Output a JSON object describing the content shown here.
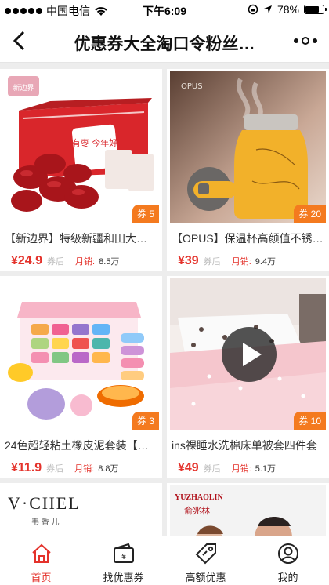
{
  "status": {
    "carrier": "中国电信",
    "time": "下午6:09",
    "battery": "78%",
    "battery_level": 0.78
  },
  "header": {
    "title": "优惠券大全淘口令粉丝…"
  },
  "labels": {
    "currency": "¥",
    "after_coupon": "券后",
    "sales": "月销:"
  },
  "products": [
    {
      "name": "【新边界】特级新疆和田大枣…",
      "price": "24.9",
      "sales": "8.5万",
      "coupon": "券 5",
      "video": false
    },
    {
      "name": "【OPUS】保温杯高颜值不锈…",
      "price": "39",
      "sales": "9.4万",
      "coupon": "券 20",
      "video": false
    },
    {
      "name": "24色超轻粘土橡皮泥套装【收…",
      "price": "11.9",
      "sales": "8.8万",
      "coupon": "券 3",
      "video": false
    },
    {
      "name": "ins裸睡水洗棉床单被套四件套",
      "price": "49",
      "sales": "5.1万",
      "coupon": "券 10",
      "video": true
    }
  ],
  "partial": [
    {
      "brand": "V·CHEL",
      "brand_sub": "韦 香 儿"
    },
    {
      "brand": "YUZHAOLIN",
      "brand_sub": "俞兆林"
    }
  ],
  "image_labels": {
    "opus": "OPUS",
    "dates_badge": "新边界",
    "dates_bag": "有枣 今年好"
  },
  "tabs": [
    {
      "label": "首页",
      "icon": "home-icon",
      "active": true
    },
    {
      "label": "找优惠券",
      "icon": "coupon-wallet-icon",
      "active": false
    },
    {
      "label": "高额优惠",
      "icon": "price-tag-icon",
      "active": false
    },
    {
      "label": "我的",
      "icon": "user-icon",
      "active": false
    }
  ],
  "colors": {
    "accent": "#e4322b",
    "coupon": "#f47a1f"
  }
}
